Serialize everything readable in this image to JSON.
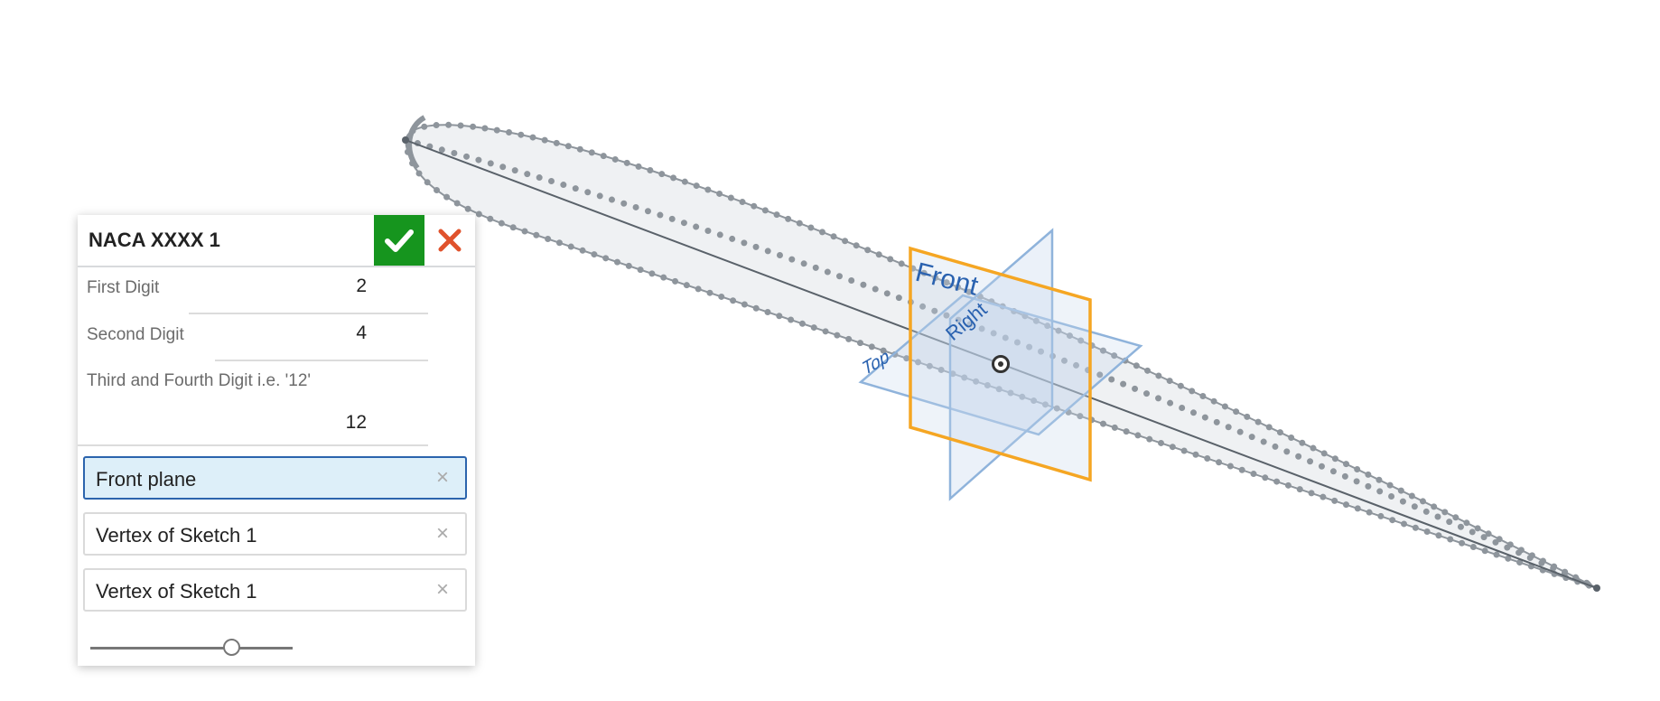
{
  "viewport": {
    "plane_labels": {
      "front": "Front",
      "top": "Top",
      "right": "Right"
    },
    "colors": {
      "selected_plane": "#f5a623",
      "plane": "#8fb3db",
      "airfoil_points": "#8e959c",
      "airfoil_fill": "#eff1f3"
    }
  },
  "panel": {
    "title": "NACA XXXX 1",
    "confirm_icon": "check-icon",
    "cancel_icon": "close-icon",
    "colors": {
      "confirm": "#16951e",
      "cancel": "#e0522c"
    },
    "fields": [
      {
        "label": "First Digit",
        "value": "2"
      },
      {
        "label": "Second Digit",
        "value": "4"
      },
      {
        "label": "Third and Fourth Digit i.e. '12'",
        "value": "12"
      }
    ],
    "selections": [
      {
        "label": "Front plane",
        "selected": true
      },
      {
        "label": "Vertex of Sketch 1",
        "selected": false
      },
      {
        "label": "Vertex of Sketch 1",
        "selected": false
      }
    ],
    "remove_glyph": "×",
    "slider_value_fraction": 0.7
  }
}
